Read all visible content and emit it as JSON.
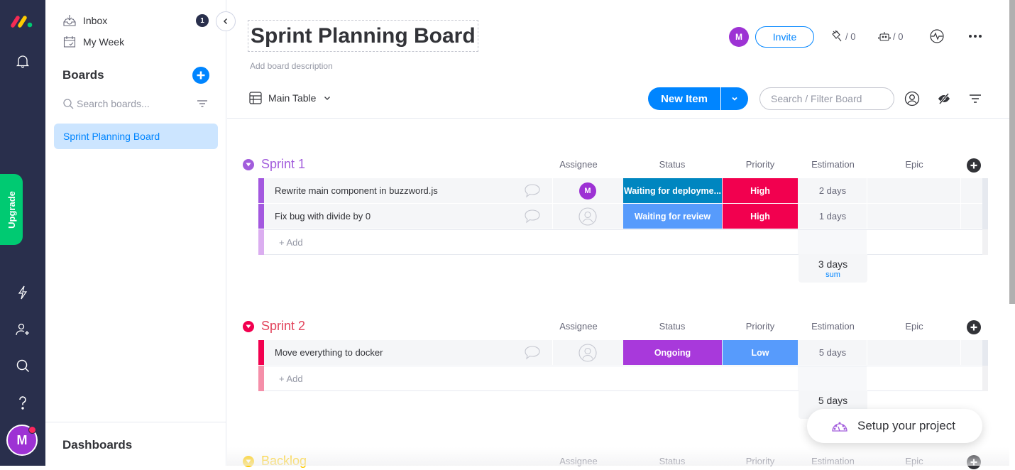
{
  "rail": {
    "upgrade_label": "Upgrade",
    "avatar_initial": "M",
    "icons": [
      "monday-logo",
      "bell-icon",
      "lightning-icon",
      "invite-user-icon",
      "search-icon",
      "help-icon"
    ]
  },
  "sidebar": {
    "inbox_label": "Inbox",
    "inbox_count": "1",
    "my_week_label": "My Week",
    "boards_title": "Boards",
    "search_placeholder": "Search boards...",
    "boards": [
      {
        "label": "Sprint Planning Board",
        "selected": true
      }
    ],
    "dashboards_title": "Dashboards"
  },
  "header": {
    "board_title": "Sprint Planning Board",
    "description_placeholder": "Add board description",
    "avatar_initial": "M",
    "invite_label": "Invite",
    "integrations_count": "/ 0",
    "automations_count": "/ 0",
    "view_label": "Main Table",
    "new_item_label": "New Item",
    "search_placeholder": "Search / Filter Board"
  },
  "colors": {
    "brand_blue": "#0085ff",
    "rail_bg": "#292f4c",
    "upgrade_green": "#00ca72"
  },
  "columns": [
    "Assignee",
    "Status",
    "Priority",
    "Estimation",
    "Epic"
  ],
  "groups": [
    {
      "title": "Sprint 1",
      "color": "#a25ddc",
      "bar_color": "#a358df",
      "add_bar_color": "#dbaef0",
      "add_label": "+ Add",
      "items": [
        {
          "name": "Rewrite main component in buzzword.js",
          "assignee": "M",
          "status": "Waiting for deployme...",
          "status_color": "#0086c0",
          "priority": "High",
          "priority_color": "#f2004f",
          "estimation": "2 days",
          "epic": ""
        },
        {
          "name": "Fix bug with divide by 0",
          "assignee": "",
          "status": "Waiting for review",
          "status_color": "#579bfc",
          "priority": "High",
          "priority_color": "#f2004f",
          "estimation": "1 days",
          "epic": ""
        }
      ],
      "estimation_sum": "3 days",
      "sum_label": "sum"
    },
    {
      "title": "Sprint 2",
      "color": "#e2445c",
      "bar_color": "#f2004f",
      "add_bar_color": "#f58fa9",
      "add_label": "+ Add",
      "items": [
        {
          "name": "Move everything to docker",
          "assignee": "",
          "status": "Ongoing",
          "status_color": "#a839db",
          "priority": "Low",
          "priority_color": "#579bfc",
          "estimation": "5 days",
          "epic": ""
        }
      ],
      "estimation_sum": "5 days",
      "sum_label": ""
    },
    {
      "title": "Backlog",
      "color": "#ffcb00",
      "items": []
    }
  ],
  "setup_label": "Setup your project"
}
